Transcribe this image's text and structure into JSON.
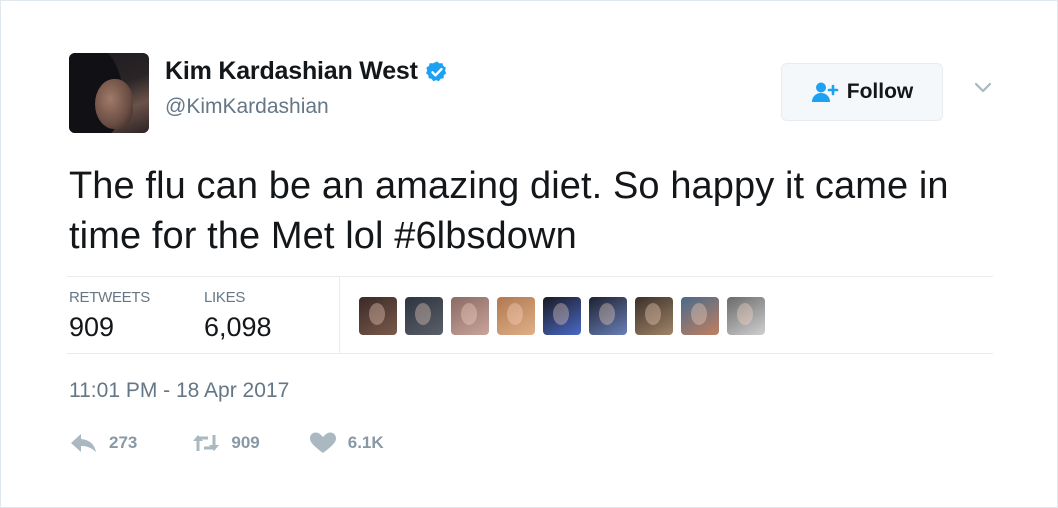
{
  "user": {
    "display_name": "Kim Kardashian West",
    "handle": "@KimKardashian",
    "verified": true
  },
  "follow_button": {
    "label": "Follow",
    "icon": "follow-person-icon"
  },
  "menu_caret": {
    "icon": "chevron-down-icon"
  },
  "tweet": {
    "text": "The flu can be an amazing diet. So happy it came in time for the Met lol #6lbsdown",
    "timestamp": "11:01 PM - 18 Apr 2017"
  },
  "stats": {
    "retweets_label": "RETWEETS",
    "retweets_value": "909",
    "likes_label": "LIKES",
    "likes_value": "6,098"
  },
  "likers": [
    {
      "colors": [
        "#3a2a28",
        "#7a5a4a"
      ]
    },
    {
      "colors": [
        "#2e3440",
        "#5a5f68"
      ]
    },
    {
      "colors": [
        "#8a6a64",
        "#c9a49a"
      ]
    },
    {
      "colors": [
        "#b07850",
        "#e0b088"
      ]
    },
    {
      "colors": [
        "#1a1a22",
        "#4a6ac8"
      ]
    },
    {
      "colors": [
        "#1d2230",
        "#6b7fb8"
      ]
    },
    {
      "colors": [
        "#3a3028",
        "#a08468"
      ]
    },
    {
      "colors": [
        "#4a6a8a",
        "#c08060"
      ]
    },
    {
      "colors": [
        "#6a6a6a",
        "#d0d0d0"
      ]
    }
  ],
  "actions": {
    "reply": {
      "icon": "reply-icon",
      "count": "273"
    },
    "retweet": {
      "icon": "retweet-icon",
      "count": "909"
    },
    "like": {
      "icon": "heart-icon",
      "count": "6.1K"
    }
  },
  "colors": {
    "text_primary": "#14171a",
    "text_secondary": "#657786",
    "action_gray": "#8899a6",
    "verified_blue": "#1da1f2",
    "border": "#e6ecf0"
  }
}
